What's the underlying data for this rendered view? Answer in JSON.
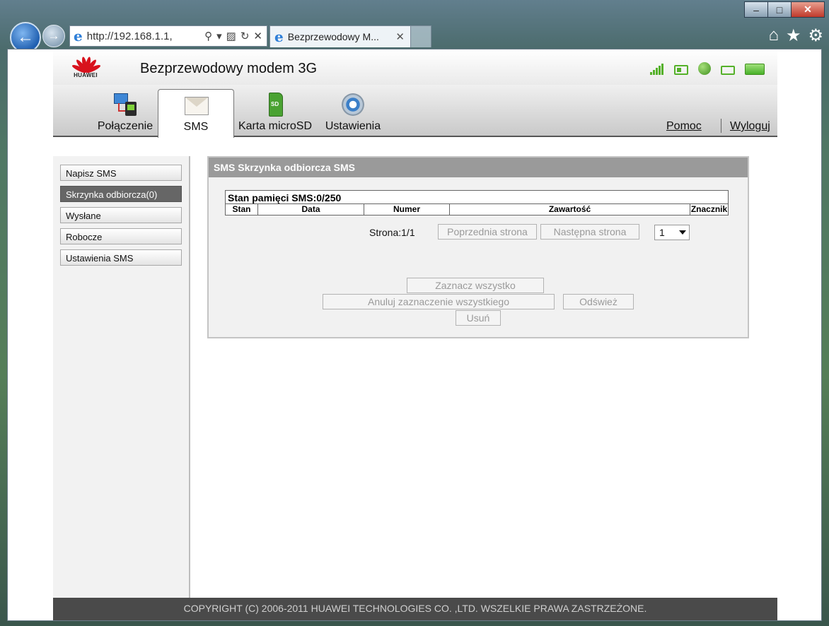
{
  "browser": {
    "url": "http://192.168.1.1,",
    "tab_title": "Bezprzewodowy M...",
    "tab_close": "✕",
    "minimize": "–",
    "maximize": "□",
    "close": "✕"
  },
  "header": {
    "logo_text": "HUAWEI",
    "title": "Bezprzewodowy modem 3G"
  },
  "tabs": [
    {
      "label": "Połączenie"
    },
    {
      "label": "SMS"
    },
    {
      "label": "Karta microSD"
    },
    {
      "label": "Ustawienia"
    }
  ],
  "top_links": {
    "help": "Pomoc",
    "logout": "Wyloguj"
  },
  "sidebar": {
    "items": [
      {
        "label": "Napisz SMS"
      },
      {
        "label": "Skrzynka odbiorcza(0)"
      },
      {
        "label": "Wysłane"
      },
      {
        "label": "Robocze"
      },
      {
        "label": "Ustawienia SMS"
      }
    ]
  },
  "panel": {
    "title": "SMS Skrzynka odbiorcza SMS",
    "storage": "Stan pamięci SMS:0/250",
    "columns": [
      "Stan",
      "Data",
      "Numer",
      "Zawartość",
      "Znacznik"
    ],
    "page_label": "Strona:1/1",
    "prev": "Poprzednia strona",
    "next": "Następna strona",
    "page_select": "1",
    "select_all": "Zaznacz wszystko",
    "deselect_all": "Anuluj zaznaczenie wszystkiego",
    "refresh": "Odśwież",
    "delete": "Usuń"
  },
  "footer": "COPYRIGHT (C) 2006-2011 HUAWEI TECHNOLOGIES CO. ,LTD. WSZELKIE PRAWA ZASTRZEŻONE."
}
